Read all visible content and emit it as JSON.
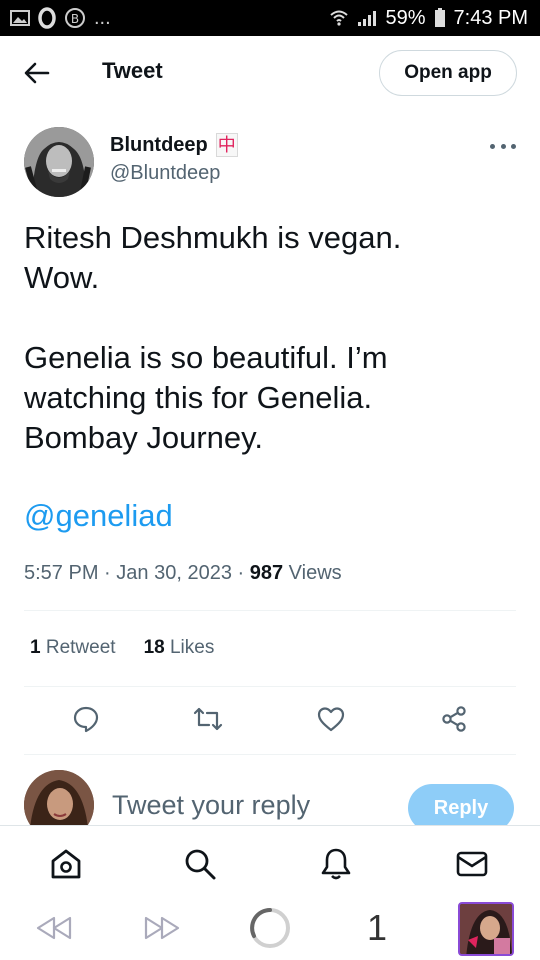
{
  "status_bar": {
    "battery": "59%",
    "time": "7:43 PM",
    "overflow": "..."
  },
  "header": {
    "title": "Tweet",
    "open_app_label": "Open app"
  },
  "author": {
    "name": "Bluntdeep",
    "handle": "@Bluntdeep",
    "badge_glyph": "中"
  },
  "tweet": {
    "line1": "Ritesh Deshmukh is vegan.",
    "line2": "Wow.",
    "line3": "Genelia is so beautiful. I’m",
    "line4": "watching this for Genelia.",
    "line5": "Bombay Journey.",
    "mention": "@geneliad"
  },
  "meta": {
    "time": "5:57 PM",
    "date": "Jan 30, 2023",
    "views_count": "987",
    "views_label": "Views",
    "sep": "·"
  },
  "stats": {
    "retweets_count": "1",
    "retweets_label": "Retweet",
    "likes_count": "18",
    "likes_label": "Likes"
  },
  "reply": {
    "placeholder": "Tweet your reply",
    "button_label": "Reply"
  },
  "browser": {
    "tab_count": "1"
  },
  "colors": {
    "accent": "#1d9bf0",
    "reply_button": "#8ecdf8",
    "text_primary": "#0f1419",
    "text_secondary": "#536471"
  },
  "icons": {
    "back": "arrow-left-icon",
    "more": "more-horizontal-icon",
    "reply": "comment-icon",
    "retweet": "retweet-icon",
    "like": "heart-icon",
    "share": "share-icon",
    "home": "home-icon",
    "search": "search-icon",
    "notifications": "bell-icon",
    "messages": "mail-icon",
    "browser_back": "browser-back-icon",
    "browser_forward": "browser-forward-icon",
    "loading": "loading-spinner-icon"
  }
}
